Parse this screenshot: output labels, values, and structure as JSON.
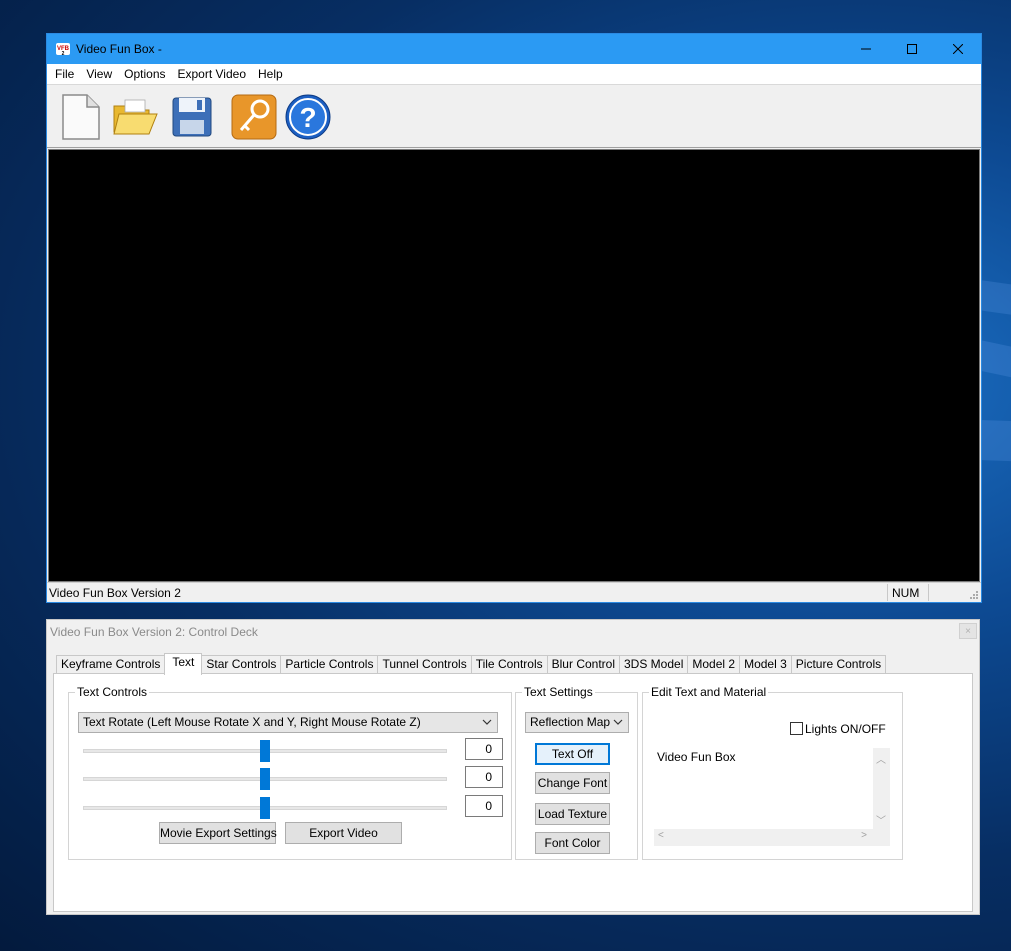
{
  "main_window": {
    "title": "Video Fun Box -",
    "menu": [
      "File",
      "View",
      "Options",
      "Export Video",
      "Help"
    ],
    "toolbar": [
      {
        "name": "new-document-icon",
        "tooltip": ""
      },
      {
        "name": "open-folder-icon",
        "tooltip": ""
      },
      {
        "name": "save-floppy-icon",
        "tooltip": ""
      },
      {
        "name": "key-icon",
        "tooltip": ""
      },
      {
        "name": "help-icon",
        "tooltip": ""
      }
    ],
    "status_text": "Video Fun Box Version 2",
    "status_num": "NUM"
  },
  "control_deck": {
    "title": "Video Fun Box Version 2: Control Deck",
    "close_label": "×",
    "tabs": [
      "Keyframe Controls",
      "Text",
      "Star Controls",
      "Particle Controls",
      "Tunnel Controls",
      "Tile Controls",
      "Blur Control",
      "3DS Model",
      "Model 2",
      "Model 3",
      "Picture Controls"
    ],
    "active_tab": "Text",
    "text_controls": {
      "legend": "Text Controls",
      "mode_select": "Text Rotate  (Left Mouse Rotate X and Y, Right Mouse Rotate Z)",
      "sliders": [
        {
          "value": "0",
          "level": 0.5
        },
        {
          "value": "0",
          "level": 0.5
        },
        {
          "value": "0",
          "level": 0.5
        }
      ],
      "movie_export_settings": "Movie Export Settings",
      "export_video": "Export Video"
    },
    "text_settings": {
      "legend": "Text Settings",
      "map_select": "Reflection Map",
      "text_off": "Text Off",
      "change_font": "Change Font",
      "load_texture": "Load Texture",
      "font_color": "Font Color"
    },
    "edit_text": {
      "legend": "Edit Text and Material",
      "lights_label": "Lights ON/OFF",
      "text_value": "Video Fun Box"
    }
  },
  "colors": {
    "titlebar": "#2b9af3",
    "slider_thumb": "#0078d7",
    "viewport": "#000000"
  }
}
